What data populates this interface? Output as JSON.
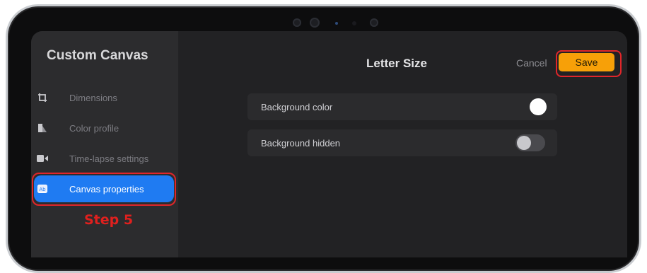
{
  "sidebar": {
    "title": "Custom Canvas",
    "items": [
      {
        "label": "Dimensions",
        "icon": "crop-icon"
      },
      {
        "label": "Color profile",
        "icon": "color-profile-icon"
      },
      {
        "label": "Time-lapse settings",
        "icon": "video-camera-icon"
      },
      {
        "label": "Canvas properties",
        "icon": "canvas-properties-icon",
        "active": true
      }
    ]
  },
  "annotation": {
    "step_label": "Step 5"
  },
  "header": {
    "title": "Letter Size",
    "cancel_label": "Cancel",
    "save_label": "Save"
  },
  "settings": [
    {
      "label": "Background color",
      "control": "color-swatch",
      "value": "#ffffff"
    },
    {
      "label": "Background hidden",
      "control": "toggle",
      "value": false
    }
  ],
  "colors": {
    "accent_blue": "#1f7bf2",
    "save_orange": "#f7a008",
    "highlight_red": "#e0262a"
  }
}
